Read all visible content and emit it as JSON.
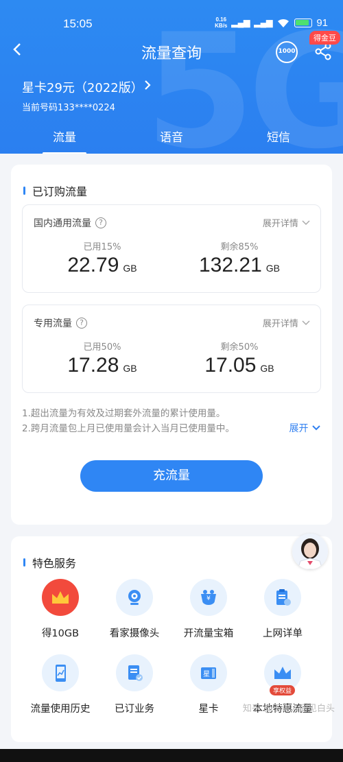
{
  "status": {
    "time": "15:05",
    "netspeed_value": "0.16",
    "netspeed_unit": "KB/s",
    "battery": "91"
  },
  "header": {
    "title": "流量查询",
    "badge": "得金豆",
    "plan_name": "星卡29元（2022版）",
    "phone": "当前号码133****0224",
    "icon_1000": "1000"
  },
  "tabs": [
    {
      "label": "流量"
    },
    {
      "label": "语音"
    },
    {
      "label": "短信"
    }
  ],
  "subscribed": {
    "title": "已订购流量",
    "packages": [
      {
        "name": "国内通用流量",
        "expand": "展开详情",
        "used_label": "已用15%",
        "used_value": "22.79",
        "remain_label": "剩余85%",
        "remain_value": "132.21",
        "unit": "GB"
      },
      {
        "name": "专用流量",
        "expand": "展开详情",
        "used_label": "已用50%",
        "used_value": "17.28",
        "remain_label": "剩余50%",
        "remain_value": "17.05",
        "unit": "GB"
      }
    ],
    "note1": "1.超出流量为有效及过期套外流量的累计使用量。",
    "note2": "2.跨月流量包上月已使用量会计入当月已使用量中。",
    "expand_more": "展开",
    "recharge_button": "充流量"
  },
  "services": {
    "title": "特色服务",
    "items": [
      {
        "label": "得10GB",
        "icon": "crown-icon"
      },
      {
        "label": "看家摄像头",
        "icon": "camera-icon"
      },
      {
        "label": "开流量宝箱",
        "icon": "treasure-icon"
      },
      {
        "label": "上网详单",
        "icon": "clipboard-icon"
      },
      {
        "label": "流量使用历史",
        "icon": "phone-chart-icon"
      },
      {
        "label": "已订业务",
        "icon": "document-check-icon"
      },
      {
        "label": "星卡",
        "icon": "card-icon"
      },
      {
        "label": "本地特惠流量",
        "icon": "crown-badge-icon",
        "badge": "享权益"
      }
    ]
  },
  "watermark": "知乎 @不许人间见白头",
  "colors": {
    "primary": "#2f86f4",
    "header": "#2b7ff0",
    "red": "#f24a3c",
    "badge": "#ff4a4a"
  }
}
